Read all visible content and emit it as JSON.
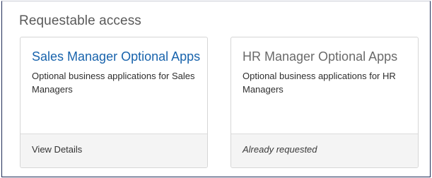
{
  "section": {
    "title": "Requestable access"
  },
  "cards": [
    {
      "title": "Sales Manager Optional Apps",
      "description": "Optional business applications for Sales Managers",
      "footer": "View Details"
    },
    {
      "title": "HR Manager Optional Apps",
      "description": "Optional business applications for HR Managers",
      "footer": "Already requested"
    }
  ],
  "colors": {
    "link": "#1863ac",
    "disabled_title": "#6a6a6a",
    "footer_bg": "#f4f4f4"
  }
}
